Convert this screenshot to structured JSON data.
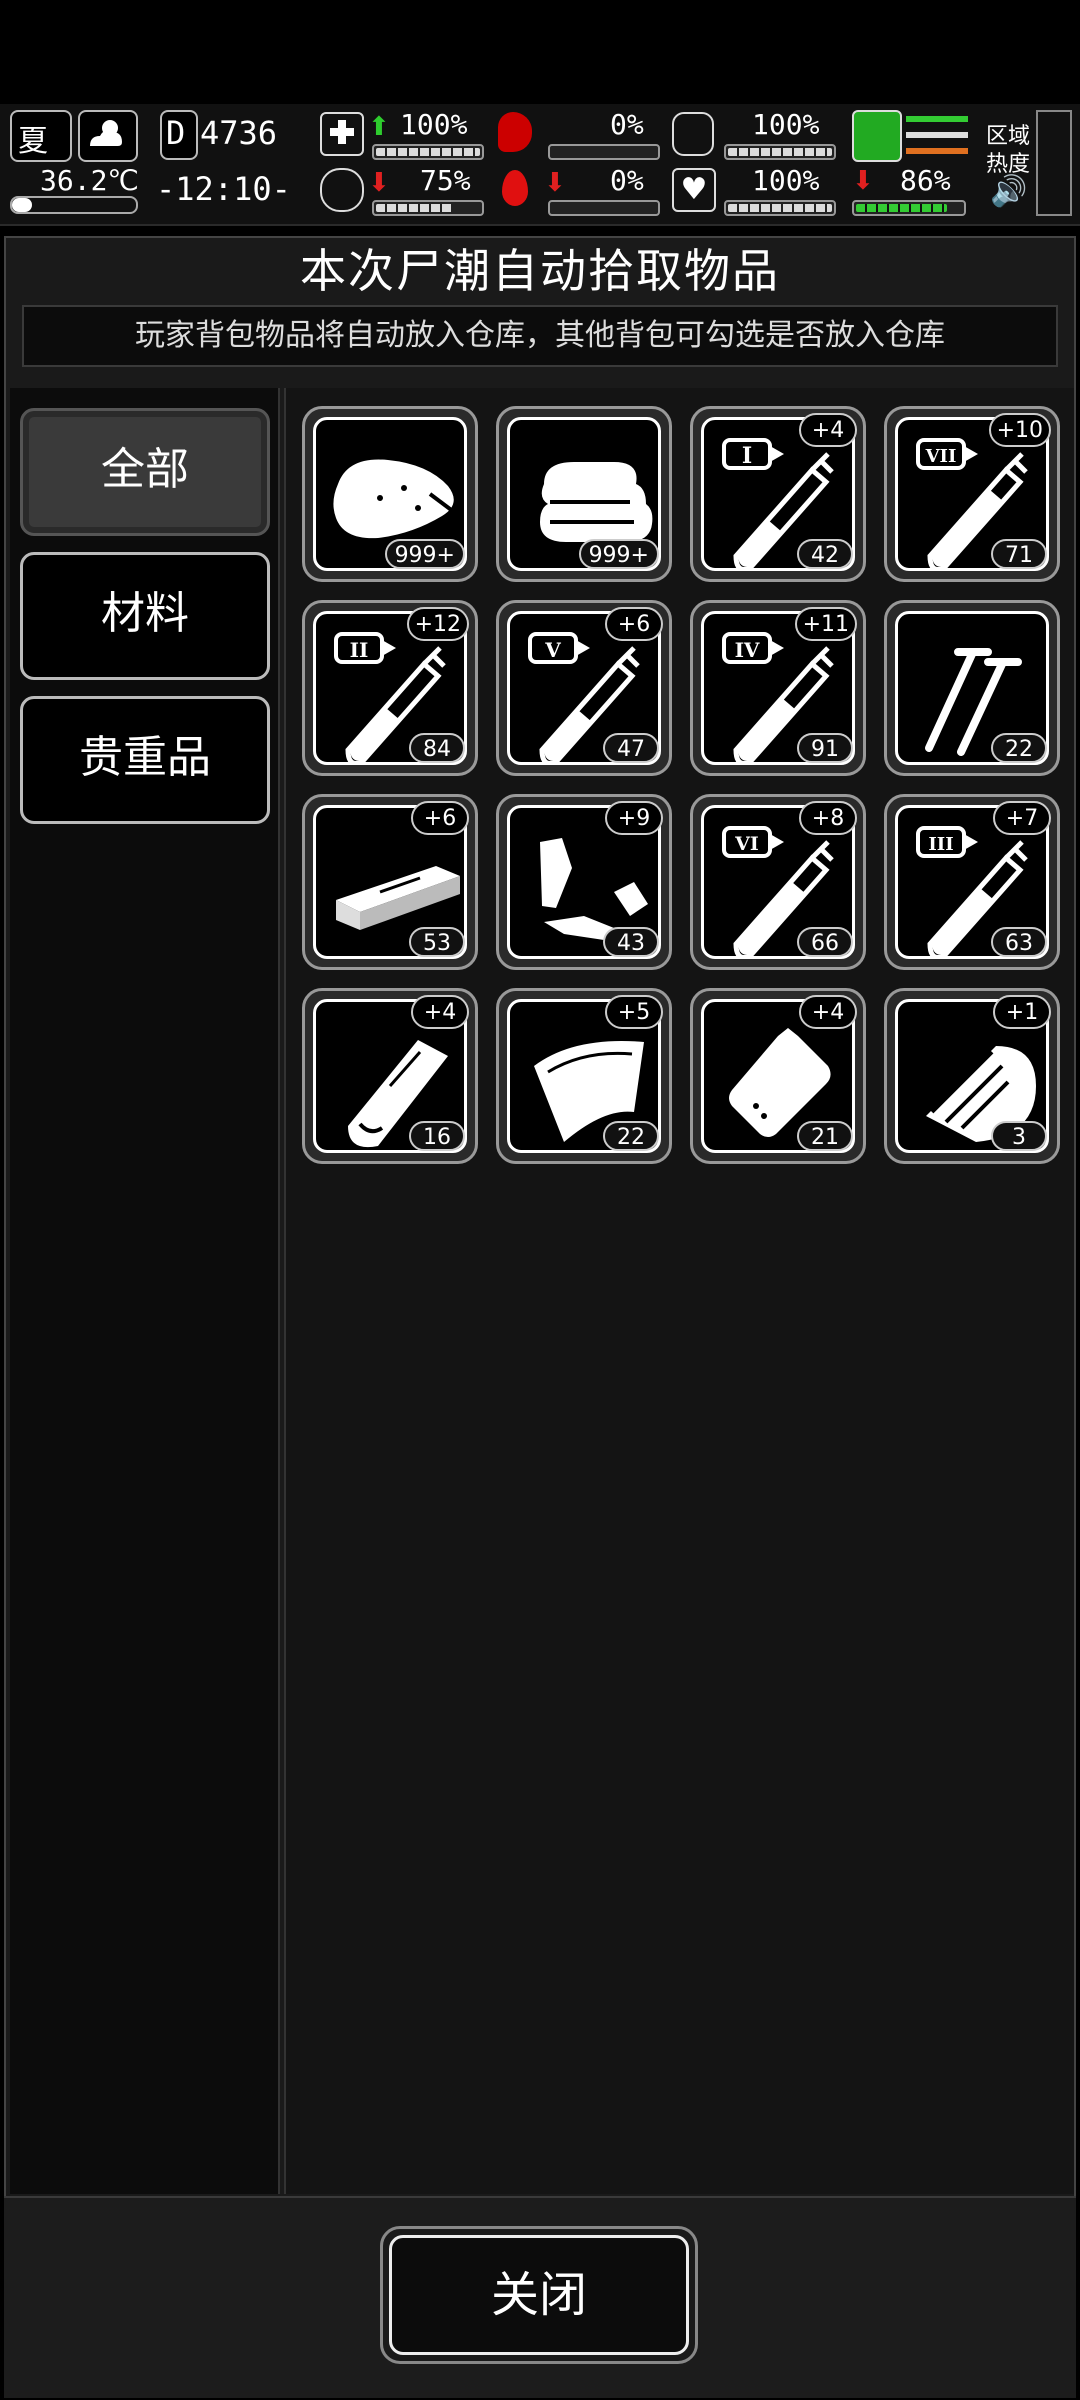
{
  "hud": {
    "season": "夏",
    "temperature": "36.2℃",
    "day_prefix": "D",
    "day": "4736",
    "clock": "-12:10-",
    "health_pct": "100%",
    "hunger_pct": "0%",
    "stamina_pct": "100%",
    "mood_pct": "75%",
    "bleed_pct": "0%",
    "heart_pct": "100%",
    "leg_pct": "86%",
    "zone_heat_label_1": "区域",
    "zone_heat_label_2": "热度",
    "bars": {
      "health": 1.0,
      "hunger": 0.0,
      "stamina": 1.0,
      "mood": 0.75,
      "bleed": 0.0,
      "heart": 1.0,
      "leg": 0.86
    },
    "colors": {
      "up": "#2ecc2e",
      "down": "#e02020",
      "leg": "#3c3"
    }
  },
  "dialog": {
    "title": "本次尸潮自动拾取物品",
    "subtitle": "玩家背包物品将自动放入仓库，其他背包可勾选是否放入仓库",
    "close_label": "关闭"
  },
  "tabs": [
    {
      "label": "全部",
      "active": true
    },
    {
      "label": "材料",
      "active": false
    },
    {
      "label": "贵重品",
      "active": false
    }
  ],
  "items": [
    {
      "icon": "meat-chunk-icon",
      "count": "999+",
      "bonus": ""
    },
    {
      "icon": "cloth-stack-icon",
      "count": "999+",
      "bonus": ""
    },
    {
      "icon": "syringe-I-icon",
      "roman": "I",
      "count": "42",
      "bonus": "+4"
    },
    {
      "icon": "syringe-VII-icon",
      "roman": "VII",
      "count": "71",
      "bonus": "+10"
    },
    {
      "icon": "syringe-II-icon",
      "roman": "II",
      "count": "84",
      "bonus": "+12"
    },
    {
      "icon": "syringe-V-icon",
      "roman": "V",
      "count": "47",
      "bonus": "+6"
    },
    {
      "icon": "syringe-IV-icon",
      "roman": "IV",
      "count": "91",
      "bonus": "+11"
    },
    {
      "icon": "nails-icon",
      "count": "22",
      "bonus": ""
    },
    {
      "icon": "wood-plank-icon",
      "count": "53",
      "bonus": "+6"
    },
    {
      "icon": "scrap-pieces-icon",
      "count": "43",
      "bonus": "+9"
    },
    {
      "icon": "syringe-VI-icon",
      "roman": "VI",
      "count": "66",
      "bonus": "+8"
    },
    {
      "icon": "syringe-III-icon",
      "roman": "III",
      "count": "63",
      "bonus": "+7"
    },
    {
      "icon": "bandage-roll-icon",
      "count": "16",
      "bonus": "+4"
    },
    {
      "icon": "fabric-sheet-icon",
      "count": "22",
      "bonus": "+5"
    },
    {
      "icon": "pouch-icon",
      "count": "21",
      "bonus": "+4"
    },
    {
      "icon": "bone-shard-icon",
      "count": "3",
      "bonus": "+1"
    }
  ]
}
